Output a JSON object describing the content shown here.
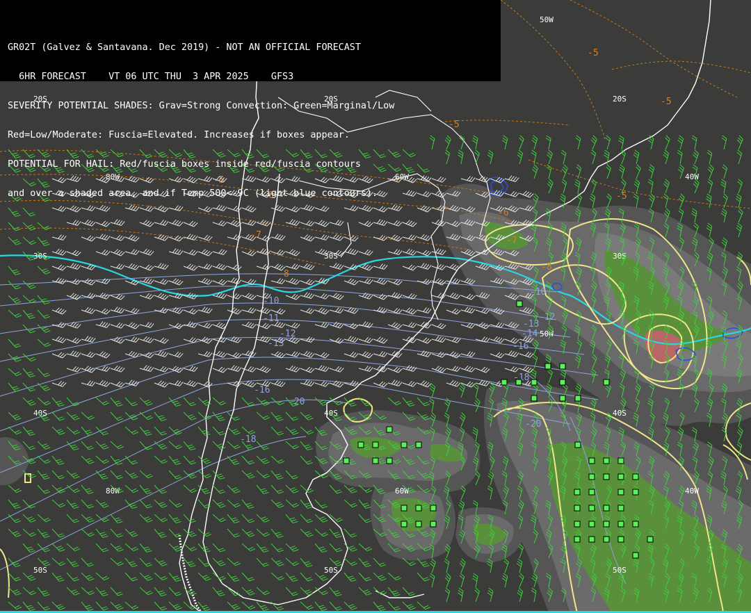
{
  "header": {
    "line1": "GR02T (Galvez & Santavana. Dec 2019) - NOT AN OFFICIAL FORECAST",
    "line2": "  6HR FORECAST    VT 06 UTC THU  3 APR 2025    GFS3",
    "line3": "SEVERITY POTENTIAL SHADES: Grav=Strong Convection: Green=Marginal/Low",
    "line4": "Red=Low/Moderate: Fuscia=Elevated. Increases if boxes appear.",
    "line5": "POTENTIAL FOR HAIL: Red/fuscia boxes inside red/fuscia contours",
    "line6": "and over a shaded area, and if Temp 500<-9C (light blue contours)."
  },
  "grid_labels": {
    "lat_20s": "20S",
    "lat_30s": "30S",
    "lat_40s": "40S",
    "lat_50s": "50S",
    "lon_80w": "80W",
    "lon_60w": "60W",
    "lon_50w": "50W",
    "lon_40w": "40W"
  },
  "contour_labels": {
    "t_minus_5": "-5",
    "t_minus_6": "-6",
    "t_minus_7": "-7",
    "t_minus_8": "-8",
    "t_minus_10": "-10",
    "t_minus_11": "-11",
    "t_minus_12": "-12",
    "t_minus_13": "-13",
    "t_minus_14": "-14",
    "t_minus_16": "-16",
    "t_minus_18": "-18",
    "t_minus_20": "-20"
  },
  "colors": {
    "background": "#3b3b39",
    "coast": "#ffffff",
    "severity_gray_outer": "#595959",
    "severity_gray_inner": "#767676",
    "severity_green": "#5a9a3c",
    "severity_red": "#c86060",
    "freezing_line": "#29d6e6",
    "temp_500_contours": "#8ea6e0",
    "temp_850_dashed": "#c8781a",
    "yellow_contours": "#f0e68a",
    "wind_barbs_green": "#3fd03f",
    "wind_barbs_white": "#e8e8e8",
    "hail_boxes": "#5cf05c"
  }
}
